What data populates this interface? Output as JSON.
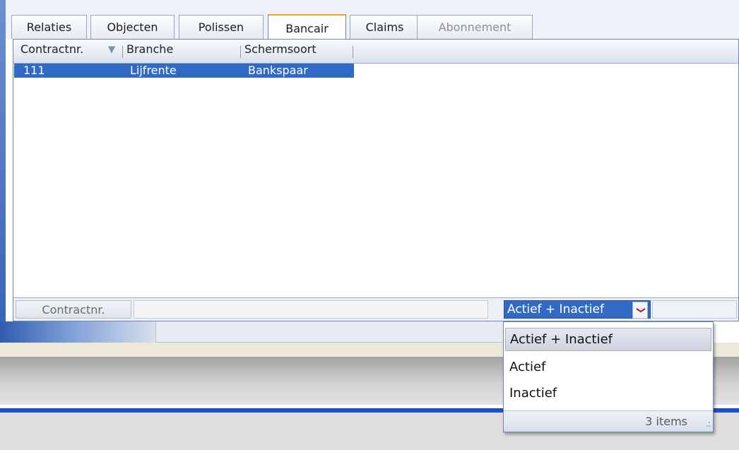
{
  "tabs": [
    {
      "label": "Relaties",
      "state": "normal"
    },
    {
      "label": "Objecten",
      "state": "normal"
    },
    {
      "label": "Polissen",
      "state": "normal"
    },
    {
      "label": "Bancair",
      "state": "active"
    },
    {
      "label": "Claims",
      "state": "normal"
    },
    {
      "label": "Abonnement",
      "state": "disabled"
    }
  ],
  "grid": {
    "columns": [
      "Contractnr.",
      "Branche",
      "Schermsoort"
    ],
    "sort_icon": "sort-down-arrow-icon",
    "rows": [
      {
        "contractnr": "111",
        "branche": "Lijfrente",
        "schermsoort": "Bankspaar",
        "selected": true
      }
    ]
  },
  "filter": {
    "label": "Contractnr.",
    "input_value": "",
    "status_selected": "Actief + Inactief",
    "dropdown_icon": "chevron-down-icon"
  },
  "dropdown": {
    "options": [
      "Actief + Inactief",
      "Actief",
      "Inactief"
    ],
    "selected_index": 0,
    "footer": "3 items"
  },
  "colors": {
    "selection": "#316ac5",
    "active_tab_accent": "#f0a030",
    "border": "#6f87b1"
  }
}
